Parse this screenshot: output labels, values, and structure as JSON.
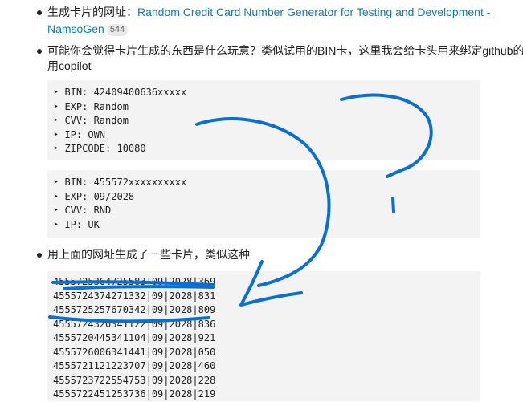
{
  "items": [
    {
      "label": "生成卡片的网址：",
      "link_line1": "Random Credit Card Number Generator for Testing and Development -",
      "link_line2": "NamsoGen",
      "badge": "544"
    },
    {
      "line1": "可能你会觉得卡片生成的东西是什么玩意？类似试用的BIN卡，这里我会给卡头用来绑定github的试",
      "line2": "用copilot"
    },
    {
      "line1": "用上面的网址生成了一些卡片，类似这种"
    }
  ],
  "code_blocks": [
    {
      "lines": [
        "‣ BIN: 42409400636xxxxx",
        "‣ EXP: Random",
        "‣ CVV: Random",
        "‣ IP: OWN",
        "‣ ZIPCODE: 10080"
      ]
    },
    {
      "lines": [
        "‣ BIN: 455572xxxxxxxxxx",
        "‣ EXP: 09/2028",
        "‣ CVV: RND",
        "‣ IP: UK"
      ]
    },
    {
      "lines": [
        "4555725364725583|09|2028|369",
        "4555724374271332|09|2028|831",
        "4555725257670342|09|2028|809",
        "4555724320341122|09|2028|836",
        "4555720445341104|09|2028|921",
        "4555726006341441|09|2028|050",
        "4555721121223707|09|2028|460",
        "4555723722554753|09|2028|228",
        "4555722451253736|09|2028|219"
      ]
    }
  ],
  "annotation_color": "#0a6fd1"
}
